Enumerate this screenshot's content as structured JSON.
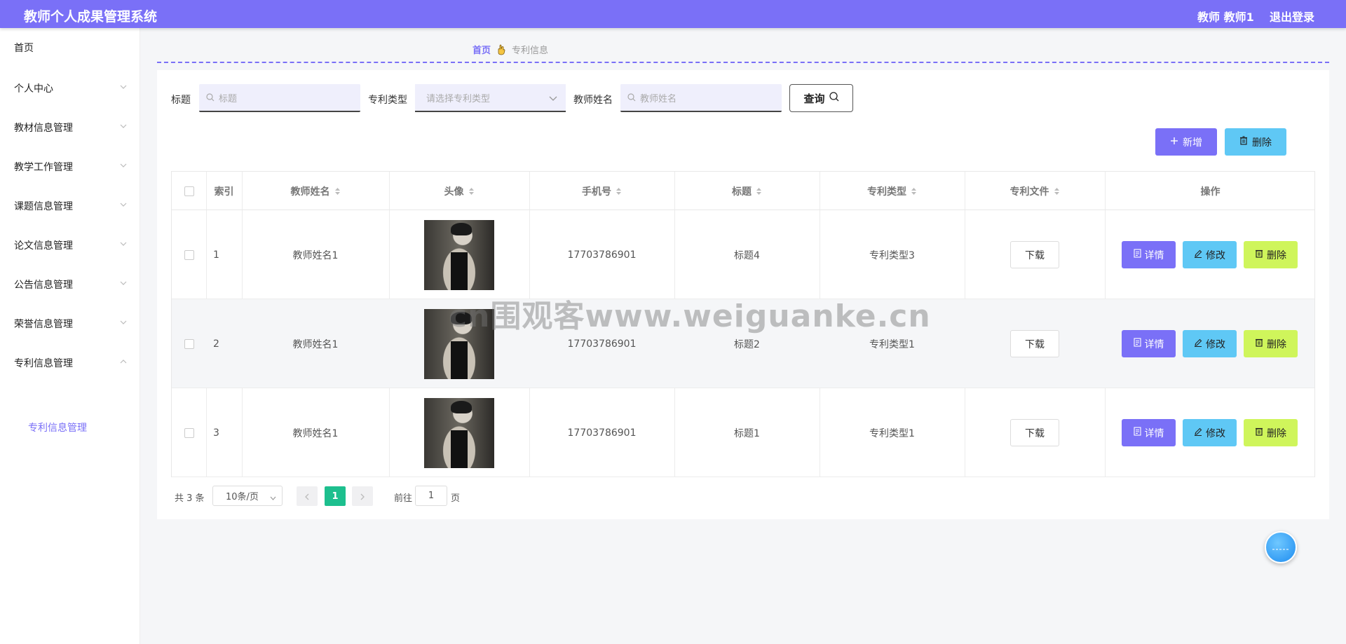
{
  "header": {
    "app_title": "教师个人成果管理系统",
    "user": "教师 教师1",
    "logout": "退出登录"
  },
  "sidebar": {
    "items": [
      {
        "label": "首页"
      },
      {
        "label": "个人中心"
      },
      {
        "label": "教材信息管理"
      },
      {
        "label": "教学工作管理"
      },
      {
        "label": "课题信息管理"
      },
      {
        "label": "论文信息管理"
      },
      {
        "label": "公告信息管理"
      },
      {
        "label": "荣誉信息管理"
      },
      {
        "label": "专利信息管理"
      }
    ],
    "active_sub": "专利信息管理"
  },
  "breadcrumb": {
    "home": "首页",
    "current": "专利信息"
  },
  "filters": {
    "title_label": "标题",
    "title_placeholder": "标题",
    "type_label": "专利类型",
    "type_placeholder": "请选择专利类型",
    "teacher_label": "教师姓名",
    "teacher_placeholder": "教师姓名",
    "query_label": "查询"
  },
  "actions": {
    "add_label": "新增",
    "delete_label": "删除"
  },
  "table": {
    "headers": [
      "索引",
      "教师姓名",
      "头像",
      "手机号",
      "标题",
      "专利类型",
      "专利文件",
      "操作"
    ],
    "rows": [
      {
        "index": "1",
        "teacher": "教师姓名1",
        "phone": "17703786901",
        "title": "标题4",
        "type": "专利类型3",
        "file": "下载"
      },
      {
        "index": "2",
        "teacher": "教师姓名1",
        "phone": "17703786901",
        "title": "标题2",
        "type": "专利类型1",
        "file": "下载"
      },
      {
        "index": "3",
        "teacher": "教师姓名1",
        "phone": "17703786901",
        "title": "标题1",
        "type": "专利类型1",
        "file": "下载"
      }
    ],
    "op_detail": "详情",
    "op_edit": "修改",
    "op_delete": "删除"
  },
  "pagination": {
    "total": "共 3 条",
    "page_size": "10条/页",
    "current": "1",
    "goto": "前往",
    "goto_value": "1",
    "page_suffix": "页"
  },
  "watermark": "cn围观客www.weiguanke.cn",
  "colors": {
    "accent": "#7a70f7",
    "info": "#5fc8f5",
    "warn": "#cff55b",
    "success": "#1dbf8e"
  }
}
